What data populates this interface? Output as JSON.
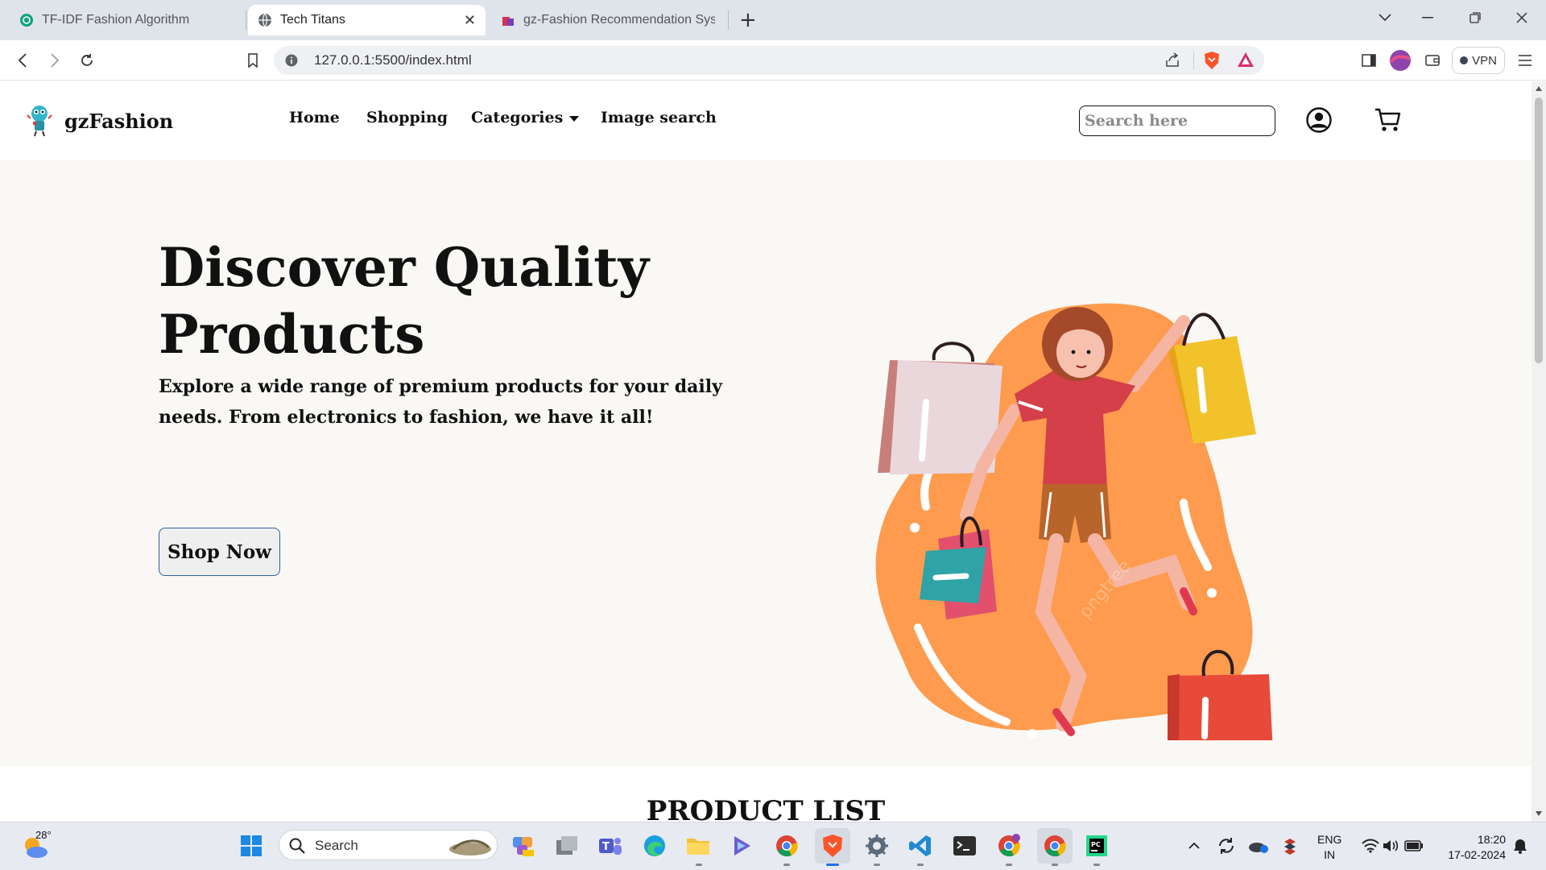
{
  "browser": {
    "tabs": [
      {
        "title": "TF-IDF Fashion Algorithm",
        "active": false
      },
      {
        "title": "Tech Titans",
        "active": true
      },
      {
        "title": "gz-Fashion Recommendation System",
        "active": false
      }
    ],
    "new_tab_label": "+",
    "url": "127.0.0.1:5500/index.html",
    "vpn_label": "VPN"
  },
  "navbar": {
    "brand": "gzFashion",
    "links": [
      "Home",
      "Shopping",
      "Categories",
      "Image search"
    ],
    "search_placeholder": "Search here"
  },
  "hero": {
    "title": "Discover Quality Products",
    "subtitle": "Explore a wide range of premium products for your daily needs. From electronics to fashion, we have it all!",
    "button": "Shop Now",
    "illustration_watermark": "pngtree"
  },
  "product_list": {
    "title": "PRODUCT LIST"
  },
  "taskbar": {
    "weather_temp": "28°",
    "search_label": "Search",
    "tray_lang_line1": "ENG",
    "tray_lang_line2": "IN",
    "time": "18:20",
    "date": "17-02-2024"
  },
  "colors": {
    "hero_bg": "#faf8f5",
    "blob": "#fe9b4e",
    "accent_blue": "#1a73e8",
    "shop_button_border": "#2f5f9e"
  }
}
